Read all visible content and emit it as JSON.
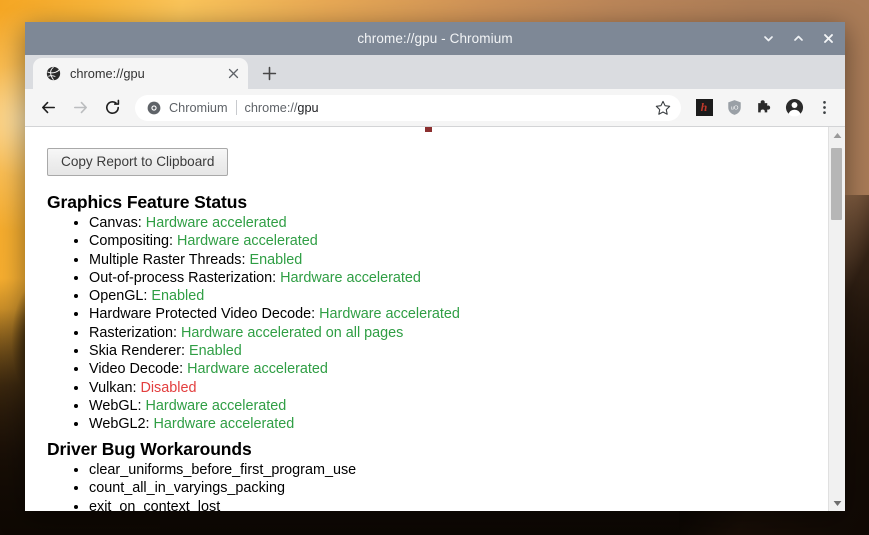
{
  "window": {
    "title": "chrome://gpu - Chromium",
    "controls": [
      {
        "name": "minimize",
        "glyph": "ˇ"
      },
      {
        "name": "maximize",
        "glyph": "ˆ"
      },
      {
        "name": "close",
        "glyph": "×"
      }
    ]
  },
  "tabstrip": {
    "tab": {
      "favicon": "globe-icon",
      "title": "chrome://gpu",
      "close_glyph": "×"
    },
    "new_tab_glyph": "+",
    "new_tab_label": "New Tab"
  },
  "toolbar": {
    "back": "back-arrow-icon",
    "forward": "forward-arrow-icon",
    "reload": "reload-icon",
    "omnibox": {
      "site_icon": "chromium-logo-icon",
      "chip_label": "Chromium",
      "url_prefix": "chrome://",
      "url_suffix": "gpu",
      "full_url": "chrome://gpu"
    },
    "star": "star-icon",
    "extensions": [
      {
        "name": "ext-hackernews",
        "label": "h"
      },
      {
        "name": "ext-ublock-origin",
        "label": "uO"
      },
      {
        "name": "ext-puzzle",
        "label": "extensions"
      }
    ],
    "profile": "profile-avatar-icon",
    "menu": "three-dot-menu-icon"
  },
  "page": {
    "copy_button": "Copy Report to Clipboard",
    "sections": [
      {
        "id": "graphics-feature-status",
        "title": "Graphics Feature Status",
        "items": [
          {
            "label": "Canvas:",
            "value": "Hardware accelerated",
            "status": "green"
          },
          {
            "label": "Compositing:",
            "value": "Hardware accelerated",
            "status": "green"
          },
          {
            "label": "Multiple Raster Threads:",
            "value": "Enabled",
            "status": "green"
          },
          {
            "label": "Out-of-process Rasterization:",
            "value": "Hardware accelerated",
            "status": "green"
          },
          {
            "label": "OpenGL:",
            "value": "Enabled",
            "status": "green"
          },
          {
            "label": "Hardware Protected Video Decode:",
            "value": "Hardware accelerated",
            "status": "green"
          },
          {
            "label": "Rasterization:",
            "value": "Hardware accelerated on all pages",
            "status": "green"
          },
          {
            "label": "Skia Renderer:",
            "value": "Enabled",
            "status": "green"
          },
          {
            "label": "Video Decode:",
            "value": "Hardware accelerated",
            "status": "green"
          },
          {
            "label": "Vulkan:",
            "value": "Disabled",
            "status": "red"
          },
          {
            "label": "WebGL:",
            "value": "Hardware accelerated",
            "status": "green"
          },
          {
            "label": "WebGL2:",
            "value": "Hardware accelerated",
            "status": "green"
          }
        ]
      },
      {
        "id": "driver-bug-workarounds",
        "title": "Driver Bug Workarounds",
        "items": [
          {
            "label": "clear_uniforms_before_first_program_use",
            "value": "",
            "status": "none"
          },
          {
            "label": "count_all_in_varyings_packing",
            "value": "",
            "status": "none"
          },
          {
            "label": "exit_on_context_lost",
            "value": "",
            "status": "none"
          }
        ]
      }
    ]
  },
  "scrollbar": {
    "up_glyph": "▲",
    "down_glyph": "▼"
  },
  "colors": {
    "titlebar": "#7e8896",
    "tabstrip": "#dadce0",
    "toolbar": "#f5f5f5",
    "status_green": "#2f9e44",
    "status_red": "#e33e3e"
  }
}
